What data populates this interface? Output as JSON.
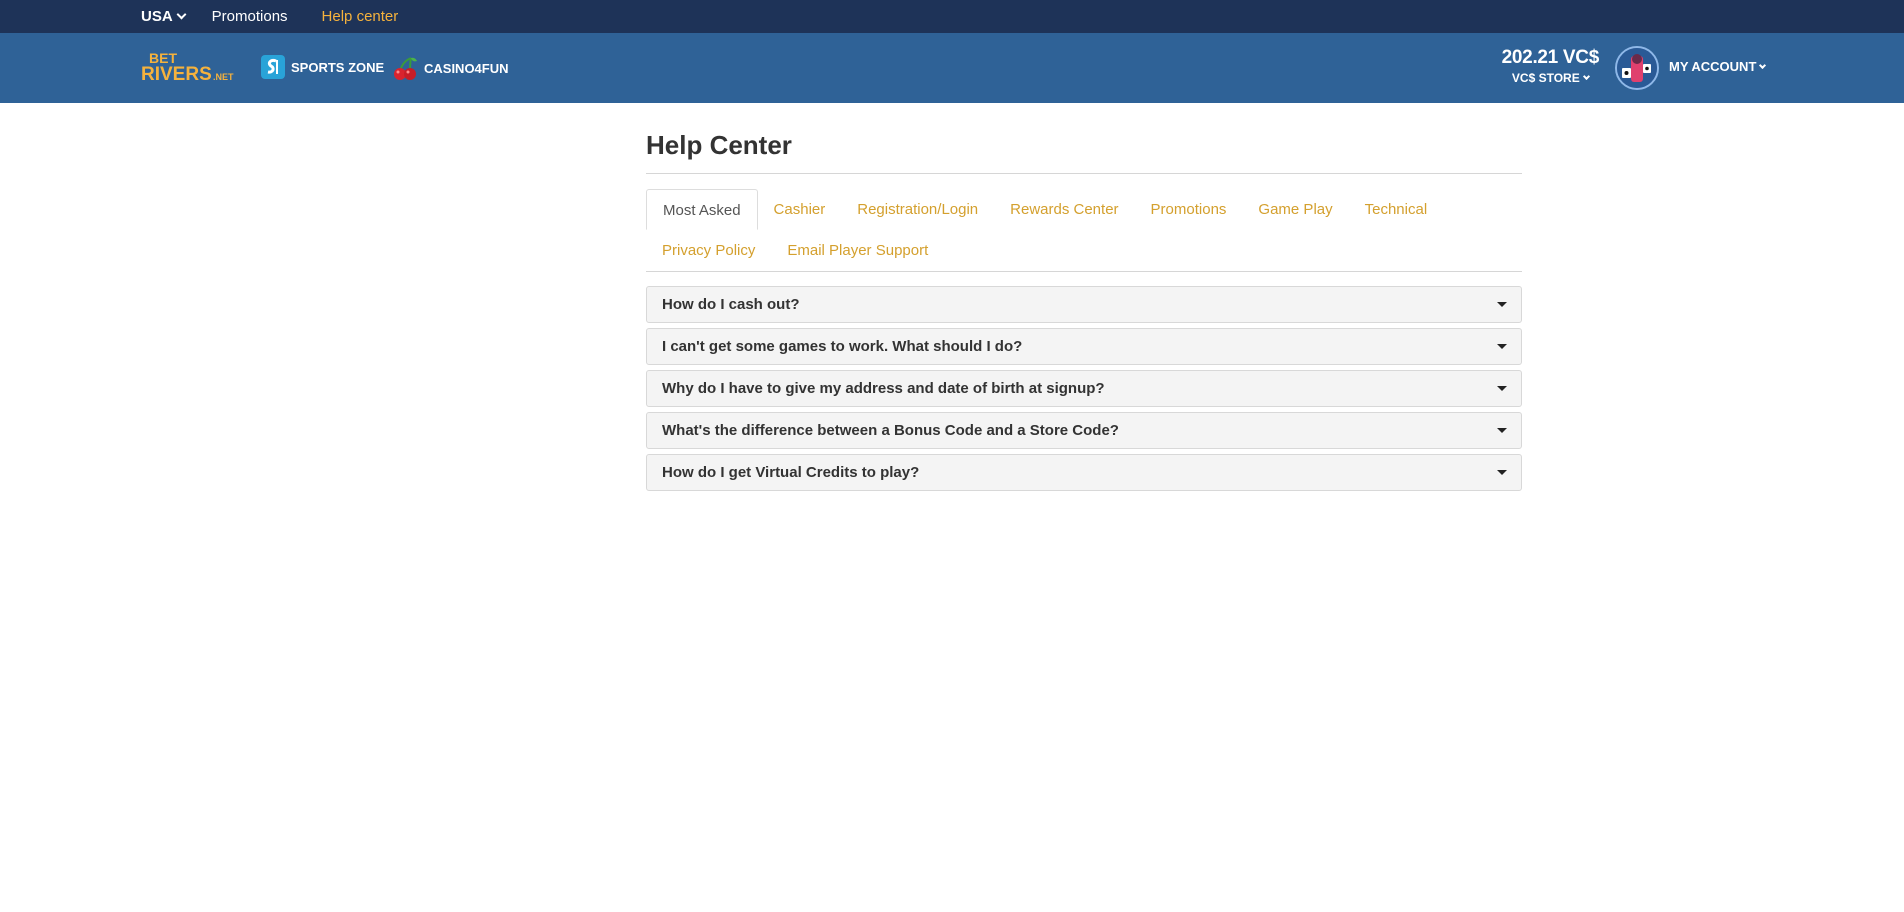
{
  "topbar": {
    "region": "USA",
    "promotions": "Promotions",
    "help_center": "Help center"
  },
  "header": {
    "logo_text_top": "BET",
    "logo_text_bottom": "RIVERS",
    "logo_suffix": ".NET",
    "sports_zone": "SPORTS ZONE",
    "casino": "CASINO4FUN",
    "balance": "202.21 VC$",
    "store": "VC$ STORE",
    "my_account": "MY ACCOUNT",
    "colors": {
      "topbar": "#1e3358",
      "header": "#2f6297",
      "accent": "#f5b23d"
    }
  },
  "page": {
    "title": "Help Center",
    "tabs": [
      {
        "label": "Most Asked",
        "active": true
      },
      {
        "label": "Cashier"
      },
      {
        "label": "Registration/Login"
      },
      {
        "label": "Rewards Center"
      },
      {
        "label": "Promotions"
      },
      {
        "label": "Game Play"
      },
      {
        "label": "Technical"
      },
      {
        "label": "Privacy Policy"
      },
      {
        "label": "Email Player Support"
      }
    ],
    "faqs": [
      "How do I cash out?",
      "I can't get some games to work. What should I do?",
      "Why do I have to give my address and date of birth at signup?",
      "What's the difference between a Bonus Code and a Store Code?",
      "How do I get Virtual Credits to play?"
    ]
  }
}
